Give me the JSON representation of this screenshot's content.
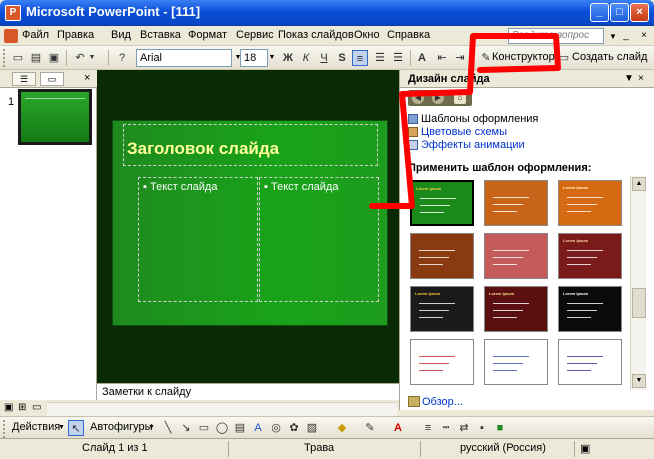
{
  "window": {
    "title": "Microsoft PowerPoint - [111]",
    "app_icon": "powerpoint-icon"
  },
  "menu": {
    "items": [
      "Файл",
      "Правка",
      "Вид",
      "Вставка",
      "Формат",
      "Сервис",
      "Показ слайдов",
      "Окно",
      "Справка"
    ],
    "help_placeholder": "Введите вопрос"
  },
  "toolbar": {
    "font_name": "Arial",
    "font_size": "18",
    "bold": "Ж",
    "italic": "К",
    "underline": "Ч",
    "shadow": "S",
    "grow_font": "A",
    "designer_label": "Конструктор",
    "new_slide_label": "Создать слайд"
  },
  "slides_panel": {
    "slide_number": "1"
  },
  "slide": {
    "title_placeholder": "Заголовок слайда",
    "text_left": "Текст слайда",
    "text_right": "Текст слайда",
    "bullet": "▪"
  },
  "notes": {
    "placeholder": "Заметки к слайду"
  },
  "task_pane": {
    "title": "Дизайн слайда",
    "links": [
      "Шаблоны оформления",
      "Цветовые схемы",
      "Эффекты анимации"
    ],
    "apply_label": "Применить шаблон оформления:",
    "browse_label": "Обзор...",
    "templates": [
      {
        "bg": "#1a8a1a",
        "accent": "#ffd24a",
        "title": "Lorem Ipsum"
      },
      {
        "bg": "#c8641a",
        "accent": "#ffe0a0",
        "title": ""
      },
      {
        "bg": "#d66a12",
        "accent": "#fff0c0",
        "title": "Lorem Ipsum"
      },
      {
        "bg": "#8a3a10",
        "accent": "#ffcc66",
        "title": ""
      },
      {
        "bg": "#c55a5a",
        "accent": "#ffe0e0",
        "title": ""
      },
      {
        "bg": "#7a1a1a",
        "accent": "#ffd0a0",
        "title": "Lorem Ipsum"
      },
      {
        "bg": "#1a1a1a",
        "accent": "#ffcc33",
        "title": "Lorem Ipsum"
      },
      {
        "bg": "#5a1010",
        "accent": "#ffdd88",
        "title": "Lorem Ipsum"
      },
      {
        "bg": "#0a0a0a",
        "accent": "#ffffff",
        "title": "Lorem Ipsum"
      },
      {
        "bg": "#ffffff",
        "accent": "#cc3333",
        "title": ""
      },
      {
        "bg": "#ffffff",
        "accent": "#3355aa",
        "title": ""
      },
      {
        "bg": "#ffffff",
        "accent": "#333399",
        "title": ""
      }
    ]
  },
  "drawing_toolbar": {
    "actions_label": "Действия",
    "autoshapes_label": "Автофигуры"
  },
  "status_bar": {
    "slide_info": "Слайд 1 из 1",
    "design_name": "Трава",
    "language": "русский (Россия)"
  },
  "colors": {
    "titlebar_blue": "#0a4fd8",
    "annotation_red": "#ff0000",
    "slide_green": "#19a319"
  }
}
